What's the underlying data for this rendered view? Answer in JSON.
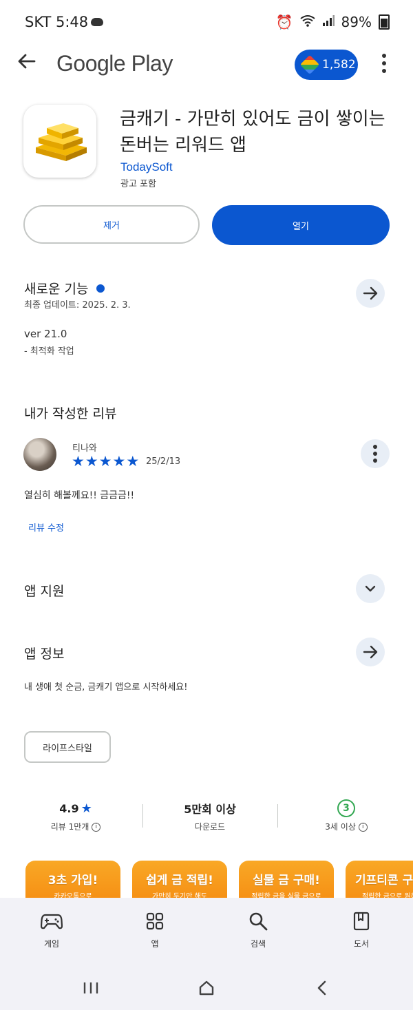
{
  "status_bar": {
    "carrier_time": "SKT 5:48",
    "battery": "89%"
  },
  "topbar": {
    "title": "Google Play",
    "points": "1,582"
  },
  "app": {
    "title": "금캐기 - 가만히 있어도 금이 쌓이는 돈버는 리워드 앱",
    "developer": "TodaySoft",
    "ads_note": "광고 포함"
  },
  "actions": {
    "remove_label": "제거",
    "open_label": "열기"
  },
  "whats_new": {
    "title": "새로운 기능",
    "updated": "최종 업데이트: 2025. 2. 3.",
    "version": "ver 21.0",
    "note": "- 최적화 작업"
  },
  "my_review": {
    "title": "내가 작성한 리뷰",
    "reviewer": "티나와",
    "rating": 5,
    "date": "25/2/13",
    "text": "열심히 해볼께요!! 금금금!!",
    "edit_label": "리뷰 수정"
  },
  "app_support": {
    "title": "앱 지원"
  },
  "app_info": {
    "title": "앱 정보",
    "description": "내 생애 첫 순금, 금캐기 앱으로 시작하세요!",
    "category_chip": "라이프스타일"
  },
  "stats": {
    "rating_value": "4.9",
    "rating_label": "리뷰 1만개",
    "downloads_value": "5만회 이상",
    "downloads_label": "다운로드",
    "age_value": "3",
    "age_label": "3세 이상"
  },
  "promo_cards": [
    {
      "title": "3초 가입!",
      "subtitle": "카카오톡으로"
    },
    {
      "title": "쉽게 금 적립!",
      "subtitle": "가만히 두기만 해도"
    },
    {
      "title": "실물 금 구매!",
      "subtitle": "적립한 금을 실물 금으로"
    },
    {
      "title": "기프티콘 구",
      "subtitle": "적립한 금으로 원하"
    }
  ],
  "bottom_nav": {
    "games": "게임",
    "apps": "앱",
    "search": "검색",
    "books": "도서"
  },
  "colors": {
    "accent": "#0b57d0",
    "promo_orange": "#f58a10",
    "age_green": "#34a853"
  }
}
